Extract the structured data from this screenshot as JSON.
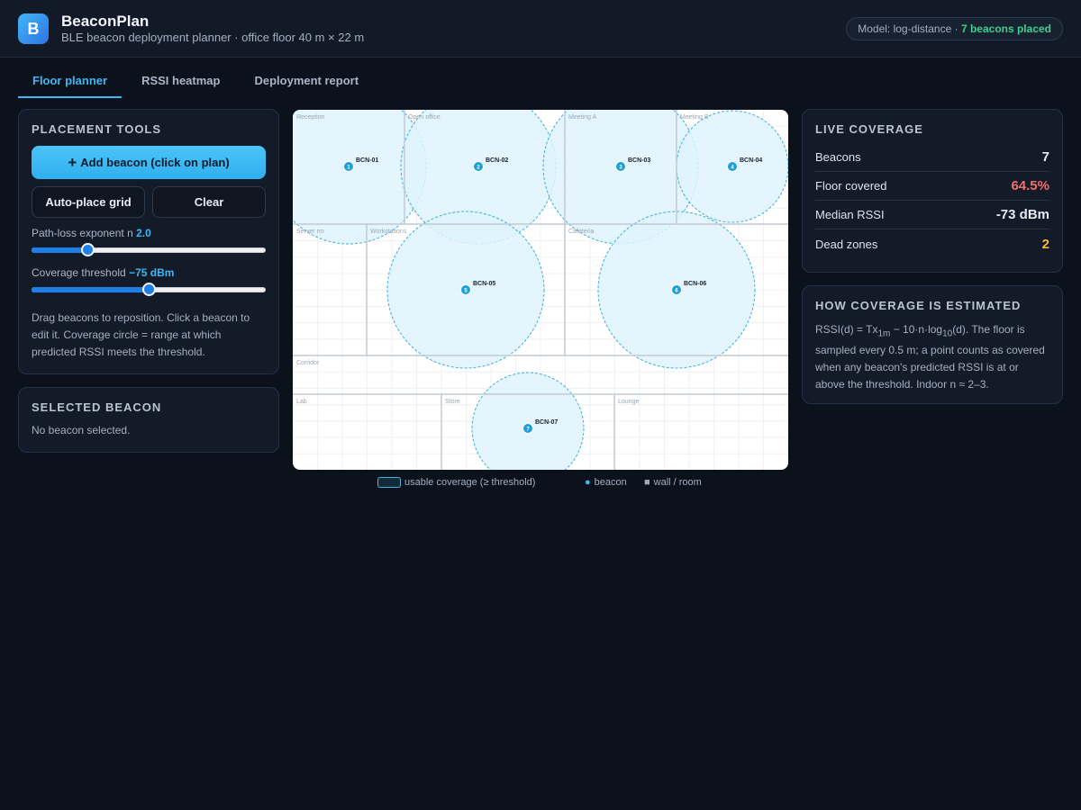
{
  "app": {
    "logo_letter": "B",
    "title": "BeaconPlan",
    "subtitle": "BLE beacon deployment planner · office floor 40 m × 22 m"
  },
  "model_pill": {
    "prefix": "Model: log-distance · ",
    "highlight": "7 beacons placed"
  },
  "tabs": [
    {
      "label": "Floor planner",
      "active": true
    },
    {
      "label": "RSSI heatmap",
      "active": false
    },
    {
      "label": "Deployment report",
      "active": false
    }
  ],
  "placement_tools": {
    "title": "PLACEMENT TOOLS",
    "add_button": "Add beacon (click on plan)",
    "add_icon": "plus-icon",
    "auto_place_button": "Auto-place grid",
    "clear_button": "Clear",
    "path_loss_label": "Path-loss exponent n ",
    "path_loss_value": "2.0",
    "path_loss_fraction": 0.24,
    "threshold_label": "Coverage threshold ",
    "threshold_value": "−75 dBm",
    "threshold_fraction": 0.5,
    "help": "Drag beacons to reposition. Click a beacon to edit it. Coverage circle = range at which predicted RSSI meets the threshold."
  },
  "selected_beacon": {
    "title": "SELECTED BEACON",
    "message": "No beacon selected."
  },
  "floor": {
    "rooms": [
      "Reception",
      "Open office",
      "Meeting A",
      "Meeting B",
      "Server rm",
      "Workstations",
      "Cafeteria",
      "Corridor",
      "Lab",
      "Store",
      "Lounge"
    ],
    "beacons": [
      {
        "index": "1",
        "id": "BCN-01"
      },
      {
        "index": "2",
        "id": "BCN-02"
      },
      {
        "index": "3",
        "id": "BCN-03"
      },
      {
        "index": "4",
        "id": "BCN-04"
      },
      {
        "index": "5",
        "id": "BCN-05"
      },
      {
        "index": "6",
        "id": "BCN-06"
      },
      {
        "index": "7",
        "id": "BCN-07"
      }
    ]
  },
  "legend": {
    "coverage": "usable coverage (≥ threshold)",
    "beacon": "beacon",
    "wall": "wall / room"
  },
  "live_coverage": {
    "title": "LIVE COVERAGE",
    "rows": [
      {
        "label": "Beacons",
        "value": "7"
      },
      {
        "label": "Floor covered",
        "value": "64.5%"
      },
      {
        "label": "Median RSSI",
        "value": "-73 dBm"
      },
      {
        "label": "Dead zones",
        "value": "2"
      }
    ]
  },
  "how_estimated": {
    "title": "HOW COVERAGE IS ESTIMATED",
    "formula_a": "RSSI(d) = Tx",
    "formula_sub1": "1m",
    "formula_b": " − 10·n·log",
    "formula_sub2": "10",
    "formula_c": "(d). The floor is sampled every 0.5 m; a point counts as covered when any beacon's predicted RSSI is at or above the threshold. Indoor n ≈ 2–3."
  },
  "colors": {
    "accent": "#3fb7f4",
    "good": "#3ecf8e",
    "bad": "#f26d6d",
    "warn": "#f5b83d",
    "coverage_fill": "#dff3fd",
    "coverage_stroke": "#3aaee0",
    "beacon_dot": "#1ca0d8"
  }
}
